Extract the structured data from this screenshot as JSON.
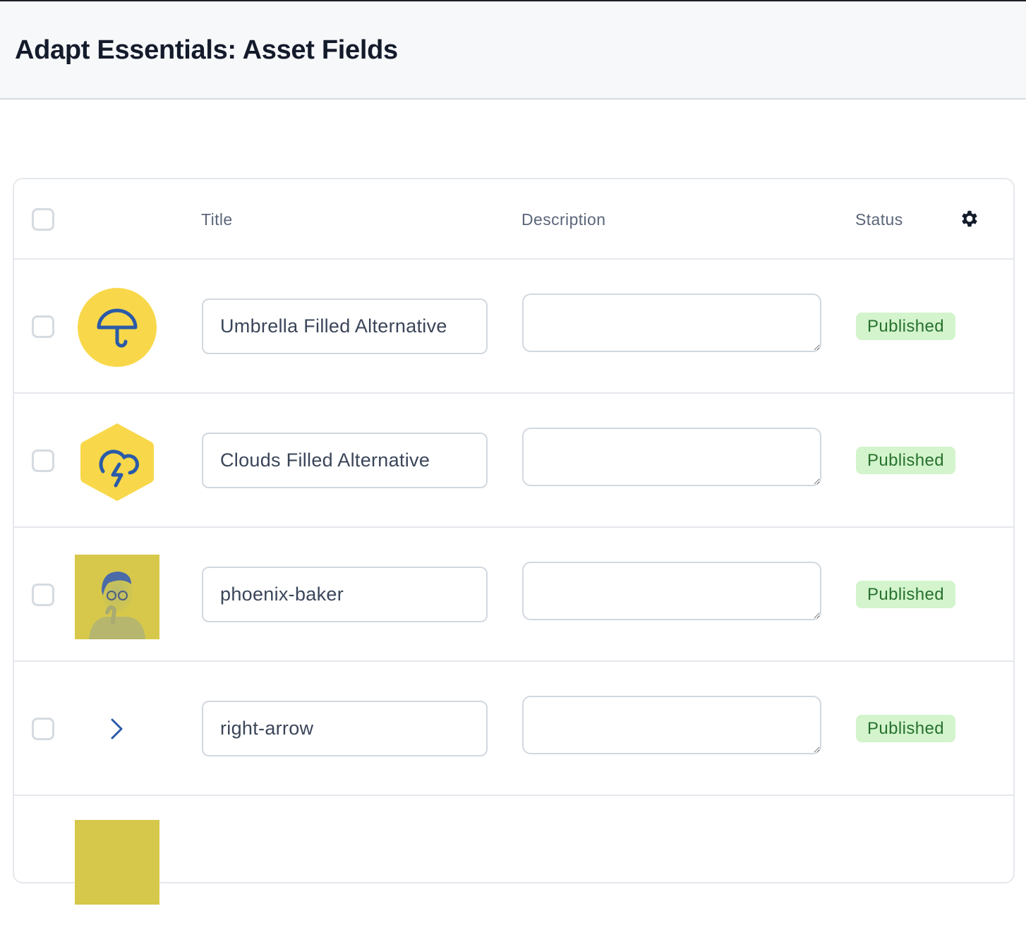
{
  "header": {
    "title": "Adapt Essentials: Asset Fields"
  },
  "table": {
    "columns": {
      "title": "Title",
      "description": "Description",
      "status": "Status"
    },
    "settings_icon": "gear-icon",
    "rows": [
      {
        "thumbnail": "umbrella-icon",
        "title": "Umbrella Filled Alternative",
        "description": "",
        "status": "Published"
      },
      {
        "thumbnail": "cloud-lightning-icon",
        "title": "Clouds Filled Alternative",
        "description": "",
        "status": "Published"
      },
      {
        "thumbnail": "portrait-photo",
        "title": "phoenix-baker",
        "description": "",
        "status": "Published"
      },
      {
        "thumbnail": "right-arrow-icon",
        "title": "right-arrow",
        "description": "",
        "status": "Published"
      },
      {
        "thumbnail": "yellow-image",
        "title": "",
        "description": "",
        "status": ""
      }
    ]
  },
  "colors": {
    "accent_yellow": "#f8d84a",
    "icon_blue": "#2a5aa8",
    "badge_bg": "#d3f4cc",
    "badge_text": "#27712e"
  }
}
